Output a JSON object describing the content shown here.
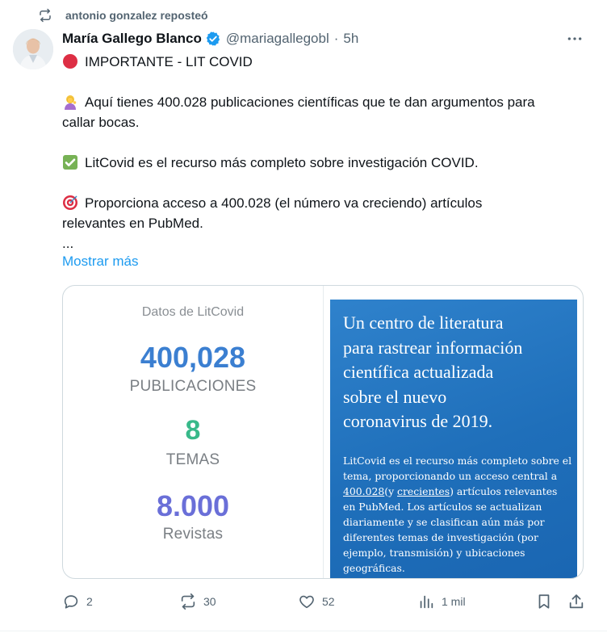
{
  "repost": {
    "text": "antonio gonzalez reposteó",
    "icon": "repost-icon"
  },
  "tweet": {
    "author": "María Gallego Blanco",
    "handle": "@mariagallegobl",
    "separator": "·",
    "time": "5h",
    "verified_color": "#1d9bf0",
    "lines": [
      {
        "emoji": "red-circle-emoji",
        "text": "IMPORTANTE - LIT COVID"
      },
      {
        "emoji": "",
        "text": ""
      },
      {
        "emoji": "person-tipping-hand-emoji",
        "text": "Aquí tienes 400.028 publicaciones científicas que te dan argumentos para"
      },
      {
        "emoji": "",
        "text": "callar bocas."
      },
      {
        "emoji": "",
        "text": ""
      },
      {
        "emoji": "check-mark-emoji",
        "text": "LitCovid es el recurso más completo sobre investigación COVID."
      },
      {
        "emoji": "",
        "text": ""
      },
      {
        "emoji": "direct-hit-emoji",
        "text": "Proporciona acceso a 400.028 (el número va creciendo) artículos"
      },
      {
        "emoji": "",
        "text": "relevantes en PubMed."
      },
      {
        "emoji": "",
        "text": "..."
      }
    ],
    "show_more": "Mostrar más"
  },
  "card": {
    "left": {
      "caption": "Datos de LitCovid",
      "stats": [
        {
          "value": "400,028",
          "label": "PUBLICACIONES",
          "color": "#3b7fd1"
        },
        {
          "value": "8",
          "label": "TEMAS",
          "color": "#38b98a"
        },
        {
          "value": "8.000",
          "label": "Revistas",
          "color": "#6a6fd8"
        }
      ]
    },
    "right": {
      "headline": [
        "Un centro de literatura",
        "para rastrear información",
        "científica actualizada",
        "sobre el nuevo",
        "coronavirus de 2019."
      ],
      "body_parts": {
        "intro": "LitCovid es el recurso más completo sobre el tema, proporcionando un acceso central a",
        "count": "400.028",
        "paren_open": "(y",
        "growing": "crecientes",
        "rest": ") artículos relevantes en PubMed. Los artículos se actualizan diariamente y se clasifican aún más por diferentes temas de investigación (por ejemplo, transmisión) y ubicaciones geográficas."
      }
    }
  },
  "actions": {
    "replies": "2",
    "reposts": "30",
    "likes": "52",
    "views": "1 mil"
  }
}
